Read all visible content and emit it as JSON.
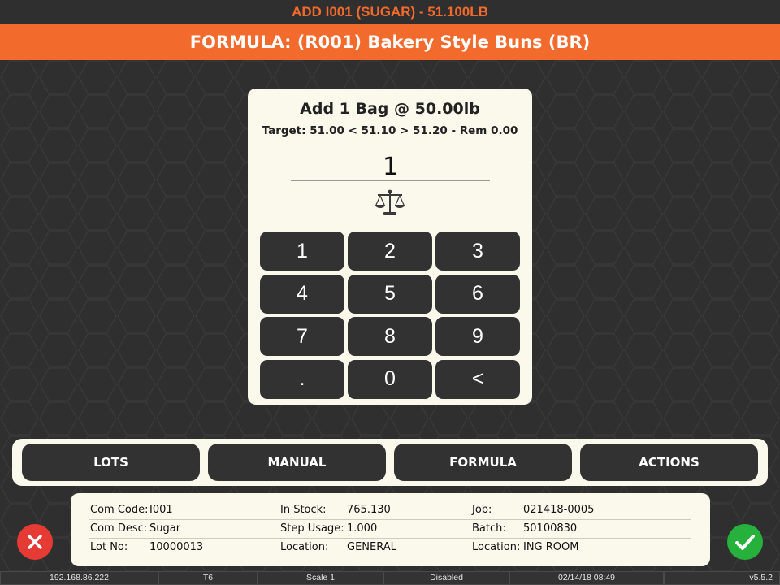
{
  "header": {
    "add_title": "ADD I001 (SUGAR) - 51.100LB",
    "formula_title": "FORMULA: (R001) Bakery Style Buns (BR)"
  },
  "prompt": {
    "title": "Add 1 Bag @ 50.00lb",
    "target_line": "Target: 51.00 < 51.10 > 51.20 - Rem 0.00",
    "entry_value": "1",
    "scale_icon": "balance-scale-icon"
  },
  "keypad": {
    "keys": [
      "1",
      "2",
      "3",
      "4",
      "5",
      "6",
      "7",
      "8",
      "9",
      ".",
      "0",
      "<"
    ]
  },
  "menu": {
    "lots": "LOTS",
    "manual": "MANUAL",
    "formula": "FORMULA",
    "actions": "ACTIONS"
  },
  "info": {
    "com_code_label": "Com Code:",
    "com_code_value": "I001",
    "com_desc_label": "Com Desc:",
    "com_desc_value": "Sugar",
    "lot_no_label": "Lot No:",
    "lot_no_value": "10000013",
    "in_stock_label": "In Stock:",
    "in_stock_value": "765.130",
    "step_usage_label": "Step Usage:",
    "step_usage_value": "1.000",
    "location_label": "Location:",
    "location_value": "GENERAL",
    "job_label": "Job:",
    "job_value": "021418-0005",
    "batch_label": "Batch:",
    "batch_value": "50100830",
    "location2_label": "Location:",
    "location2_value": "ING ROOM"
  },
  "status": {
    "ip": "192.168.86.222",
    "terminal": "T6",
    "scale": "Scale 1",
    "state": "Disabled",
    "datetime": "02/14/18 08:49",
    "version": "v5.5.2"
  },
  "colors": {
    "accent": "#f26a2c",
    "background": "#2f2f2f",
    "panel": "#fbf8ec",
    "key": "#323232",
    "cancel": "#e63b35",
    "ok": "#26b03c"
  }
}
